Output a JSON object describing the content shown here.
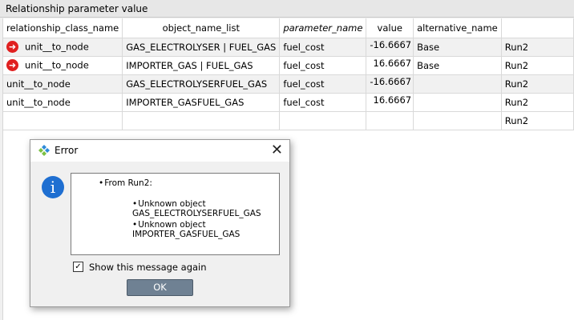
{
  "window": {
    "title": "Relationship parameter value"
  },
  "table": {
    "headers": [
      "relationship_class_name",
      "object_name_list",
      "parameter_name",
      "value",
      "alternative_name",
      ""
    ],
    "rows": [
      {
        "cls": "unit__to_node",
        "obj": "GAS_ELECTROLYSER | FUEL_GAS",
        "param": "fuel_cost",
        "value": "-16.6667",
        "alt": "Base",
        "db": "Run2"
      },
      {
        "cls": "unit__to_node",
        "obj": "IMPORTER_GAS | FUEL_GAS",
        "param": "fuel_cost",
        "value": "16.6667",
        "alt": "Base",
        "db": "Run2"
      },
      {
        "cls": "unit__to_node",
        "obj": "GAS_ELECTROLYSERFUEL_GAS",
        "param": "fuel_cost",
        "value": "-16.6667",
        "alt": "",
        "db": "Run2"
      },
      {
        "cls": "unit__to_node",
        "obj": "IMPORTER_GASFUEL_GAS",
        "param": "fuel_cost",
        "value": "16.6667",
        "alt": "",
        "db": "Run2"
      },
      {
        "cls": "",
        "obj": "",
        "param": "",
        "value": "",
        "alt": "",
        "db": "Run2"
      }
    ]
  },
  "dialog": {
    "title": "Error",
    "message_heading": "From Run2:",
    "items": [
      {
        "line1": "Unknown object",
        "line2": "GAS_ELECTROLYSERFUEL_GAS"
      },
      {
        "line1": "Unknown object",
        "line2": "IMPORTER_GASFUEL_GAS"
      }
    ],
    "checkbox_label": "Show this message again",
    "checkbox_checked": true,
    "ok_label": "OK",
    "icons": {
      "logo": "app-logo-icon",
      "info": "info-icon",
      "close": "close-icon",
      "row_marker": "arrow-right-circle-icon"
    }
  },
  "colors": {
    "row_marker": "#e02020",
    "info": "#1f6fd1",
    "ok_button": "#6f8193"
  }
}
